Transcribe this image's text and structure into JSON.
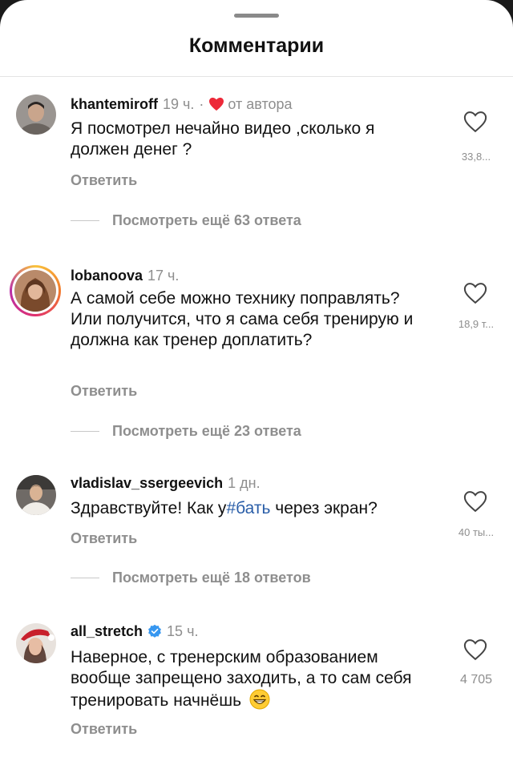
{
  "sheet": {
    "title": "Комментарии"
  },
  "comments": [
    {
      "username": "khantemiroff",
      "time": "19 ч.",
      "separator": "·",
      "author_badge": "от автора",
      "text": "Я посмотрел нечайно видео ,сколько я должен денег ?",
      "likes": "33,8...",
      "reply_label": "Ответить",
      "more_replies": "Посмотреть ещё 63 ответа",
      "avatar_icon": "avatar-photo"
    },
    {
      "username": "lobanoova",
      "time": "17 ч.",
      "text": "А самой себе можно технику поправлять? Или получится, что я сама себя тренирую и должна как тренер доплатить?",
      "likes": "18,9 т...",
      "reply_label": "Ответить",
      "more_replies": "Посмотреть ещё 23 ответа",
      "avatar_icon": "avatar-photo-with-story-ring"
    },
    {
      "username": "vladislav_ssergeevich",
      "time": "1 дн.",
      "text_before": "Здравствуйте! Как у",
      "hashtag": "#бать",
      "text_after": " через экран?",
      "likes": "40 ты...",
      "reply_label": "Ответить",
      "more_replies": "Посмотреть ещё 18 ответов",
      "avatar_icon": "avatar-photo"
    },
    {
      "username": "all_stretch",
      "time": "15 ч.",
      "text": "Наверное, с тренерским образованием вообще запрещено заходить, а то сам себя тренировать начнёшь",
      "likes": "4 705",
      "reply_label": "Ответить",
      "avatar_icon": "avatar-photo",
      "verified_icon": "verified-badge-icon",
      "emoji_icon": "grinning-face-emoji"
    }
  ],
  "colors": {
    "heart_red": "#ed2939",
    "hashtag_blue": "#2a5ea8",
    "verified_blue": "#3797f0",
    "muted_gray": "#8e8e8e"
  }
}
